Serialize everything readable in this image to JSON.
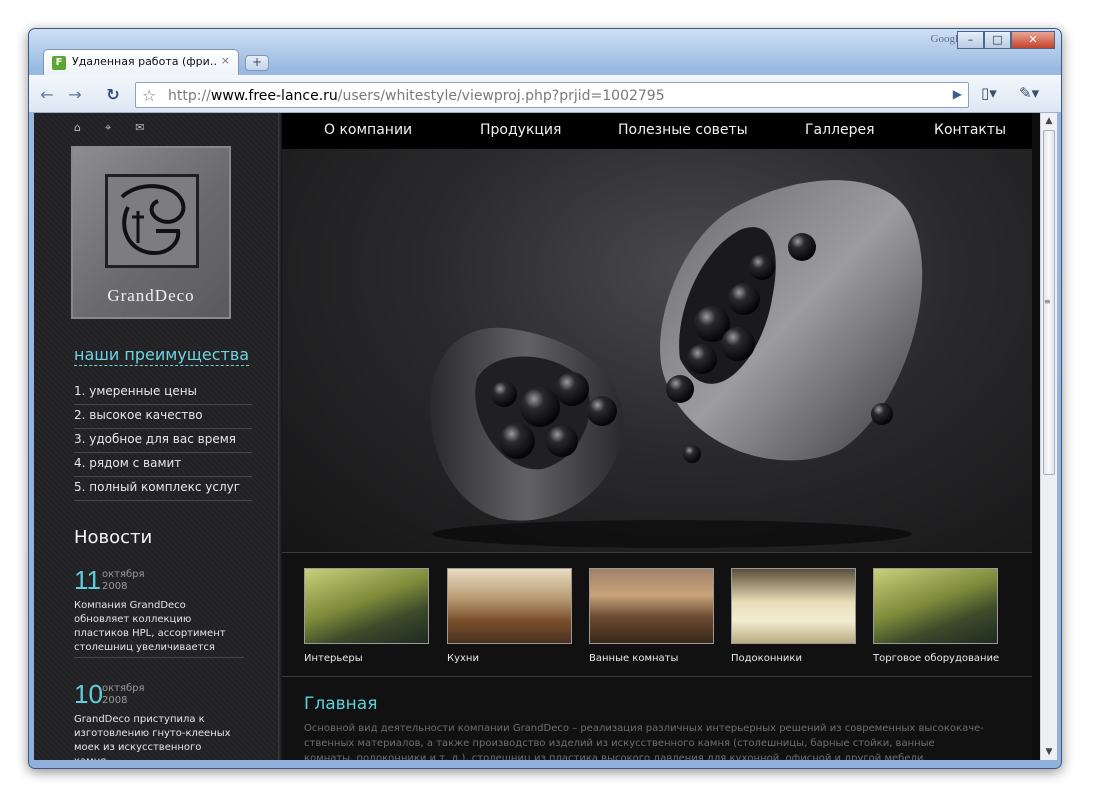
{
  "browser": {
    "brand": "Google",
    "tab_title": "Удаленная работа (фри…",
    "tab_favicon": "F",
    "tab_close": "×",
    "new_tab": "+",
    "url_scheme": "http://",
    "url_host": "www.free-lance.ru",
    "url_path": "/users/whitestyle/viewproj.php?prjid=1002795",
    "buttons": {
      "minimize": "–",
      "maximize": "□",
      "close": "✕"
    }
  },
  "site": {
    "nav": [
      "О компании",
      "Продукция",
      "Полезные советы",
      "Галлерея",
      "Контакты"
    ],
    "logo_text": "GrandDeco",
    "advantages_title": "наши преимущества",
    "advantages": [
      "1. умеренные цены",
      "2. высокое качество",
      "3. удобное для вас время",
      "4. рядом с вамит",
      "5. полный комплекс услуг"
    ],
    "news_title": "Новости",
    "news": [
      {
        "day": "11",
        "month": "октября",
        "year": "2008",
        "text": "Компания GrandDeco обновляет коллекцию пластиков HPL, ассортимент столешниц увеличивается"
      },
      {
        "day": "10",
        "month": "октября",
        "year": "2008",
        "text": "GrandDeco приступила к изготовлению гнуто-клееных моек из искусственного камня"
      }
    ],
    "categories": [
      {
        "label": "Интерьеры",
        "color": "#7d8a3a"
      },
      {
        "label": "Кухни",
        "color": "#8a6a45"
      },
      {
        "label": "Ванные комнаты",
        "color": "#9a6a3e"
      },
      {
        "label": "Подоконники",
        "color": "#d8d0a8"
      },
      {
        "label": "Торговое оборудование",
        "color": "#7d8a3a"
      }
    ],
    "page_title": "Главная",
    "page_text": "Основной вид деятельности компании GrandDeco – реализация различных интерьерных решений из современных высококаче-ственных материалов, а также производство изделий из искусственного камня (столешницы, барные стойки, ванные комнаты, подоконники и т. д.), столешниц из пластика высокого давления для кухонной, офисной и другой мебели."
  }
}
